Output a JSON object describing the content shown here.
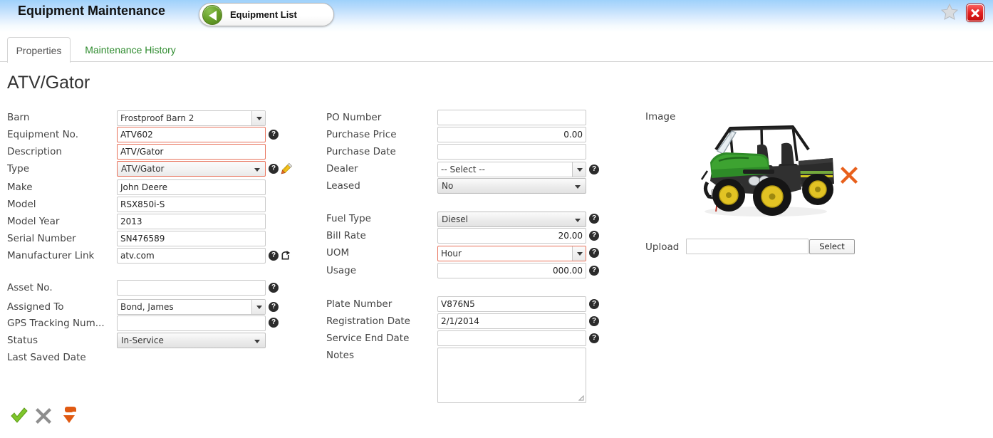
{
  "window": {
    "app_title": "Equipment Maintenance",
    "back_button_label": "Equipment List",
    "favorite_icon": "star-icon",
    "close_icon": "close-icon"
  },
  "tabs": [
    {
      "label": "Properties",
      "active": true
    },
    {
      "label": "Maintenance History",
      "active": false
    }
  ],
  "page": {
    "heading": "ATV/Gator"
  },
  "left_column": {
    "fields": [
      {
        "label": "Barn",
        "value": "Frostproof Barn 2",
        "control": "combo",
        "required": false,
        "help": false
      },
      {
        "label": "Equipment No.",
        "value": "ATV602",
        "control": "text",
        "required": true,
        "help": true
      },
      {
        "label": "Description",
        "value": "ATV/Gator",
        "control": "text",
        "required": true,
        "help": false
      },
      {
        "label": "Type",
        "value": "ATV/Gator",
        "control": "select",
        "required": true,
        "help": true,
        "edit_icon": "pencil-icon"
      },
      {
        "label": "Make",
        "value": "John Deere",
        "control": "text",
        "required": false,
        "help": false
      },
      {
        "label": "Model",
        "value": "RSX850i-S",
        "control": "text",
        "required": false,
        "help": false
      },
      {
        "label": "Model Year",
        "value": "2013",
        "control": "text",
        "required": false,
        "help": false
      },
      {
        "label": "Serial Number",
        "value": "SN476589",
        "control": "text",
        "required": false,
        "help": false
      },
      {
        "label": "Manufacturer Link",
        "value": "atv.com",
        "control": "text",
        "required": false,
        "help": true,
        "link_icon": "external-link-icon"
      },
      {
        "label": "Asset No.",
        "value": "",
        "control": "text",
        "required": false,
        "help": true
      },
      {
        "label": "Assigned To",
        "value": "Bond, James",
        "control": "combo",
        "required": false,
        "help": true
      },
      {
        "label": "GPS Tracking Num...",
        "value": "",
        "control": "text",
        "required": false,
        "help": true
      },
      {
        "label": "Status",
        "value": "In-Service",
        "control": "select",
        "required": false,
        "help": false
      },
      {
        "label": "Last Saved Date",
        "value": "",
        "control": "none",
        "required": false,
        "help": false
      }
    ]
  },
  "middle_column": {
    "fields": [
      {
        "label": "PO Number",
        "value": "",
        "control": "text",
        "required": false,
        "help": false,
        "align": "left"
      },
      {
        "label": "Purchase Price",
        "value": "0.00",
        "control": "text",
        "required": false,
        "help": false,
        "align": "right"
      },
      {
        "label": "Purchase Date",
        "value": "",
        "control": "text",
        "required": false,
        "help": false,
        "align": "left"
      },
      {
        "label": "Dealer",
        "value": "-- Select --",
        "control": "combo",
        "required": false,
        "help": true,
        "align": "left"
      },
      {
        "label": "Leased",
        "value": "No",
        "control": "select",
        "required": false,
        "help": false,
        "align": "left"
      },
      {
        "label": "Fuel Type",
        "value": "Diesel",
        "control": "select",
        "required": false,
        "help": true,
        "align": "left"
      },
      {
        "label": "Bill Rate",
        "value": "20.00",
        "control": "text",
        "required": false,
        "help": true,
        "align": "right"
      },
      {
        "label": "UOM",
        "value": "Hour",
        "control": "combo",
        "required": true,
        "help": true,
        "align": "left"
      },
      {
        "label": "Usage",
        "value": "000.00",
        "control": "text",
        "required": false,
        "help": true,
        "align": "right"
      },
      {
        "label": "Plate Number",
        "value": "V876N5",
        "control": "text",
        "required": false,
        "help": true,
        "align": "left"
      },
      {
        "label": "Registration Date",
        "value": "2/1/2014",
        "control": "text",
        "required": false,
        "help": true,
        "align": "left"
      },
      {
        "label": "Service End Date",
        "value": "",
        "control": "text",
        "required": false,
        "help": true,
        "align": "left"
      },
      {
        "label": "Notes",
        "value": "",
        "control": "textarea",
        "required": false,
        "help": false,
        "align": "left"
      }
    ]
  },
  "right_column": {
    "image_label": "Image",
    "image_alt": "John Deere Gator utility vehicle",
    "remove_image_icon": "x-remove-icon",
    "upload_label": "Upload",
    "upload_value": "",
    "select_button_label": "Select"
  },
  "actions": [
    {
      "name": "save",
      "icon": "check-icon",
      "color": "#76c225"
    },
    {
      "name": "cancel",
      "icon": "x-gray-icon",
      "color": "#8e8e8e"
    },
    {
      "name": "delete",
      "icon": "down-arrow-icon",
      "color": "#e05a12"
    }
  ],
  "colors": {
    "header_blue": "#9fd1fb",
    "tab_green": "#2e8b2e",
    "required_border": "#e8715a",
    "accent_orange": "#e8601c",
    "close_red": "#e22020"
  },
  "help_glyph": "?"
}
